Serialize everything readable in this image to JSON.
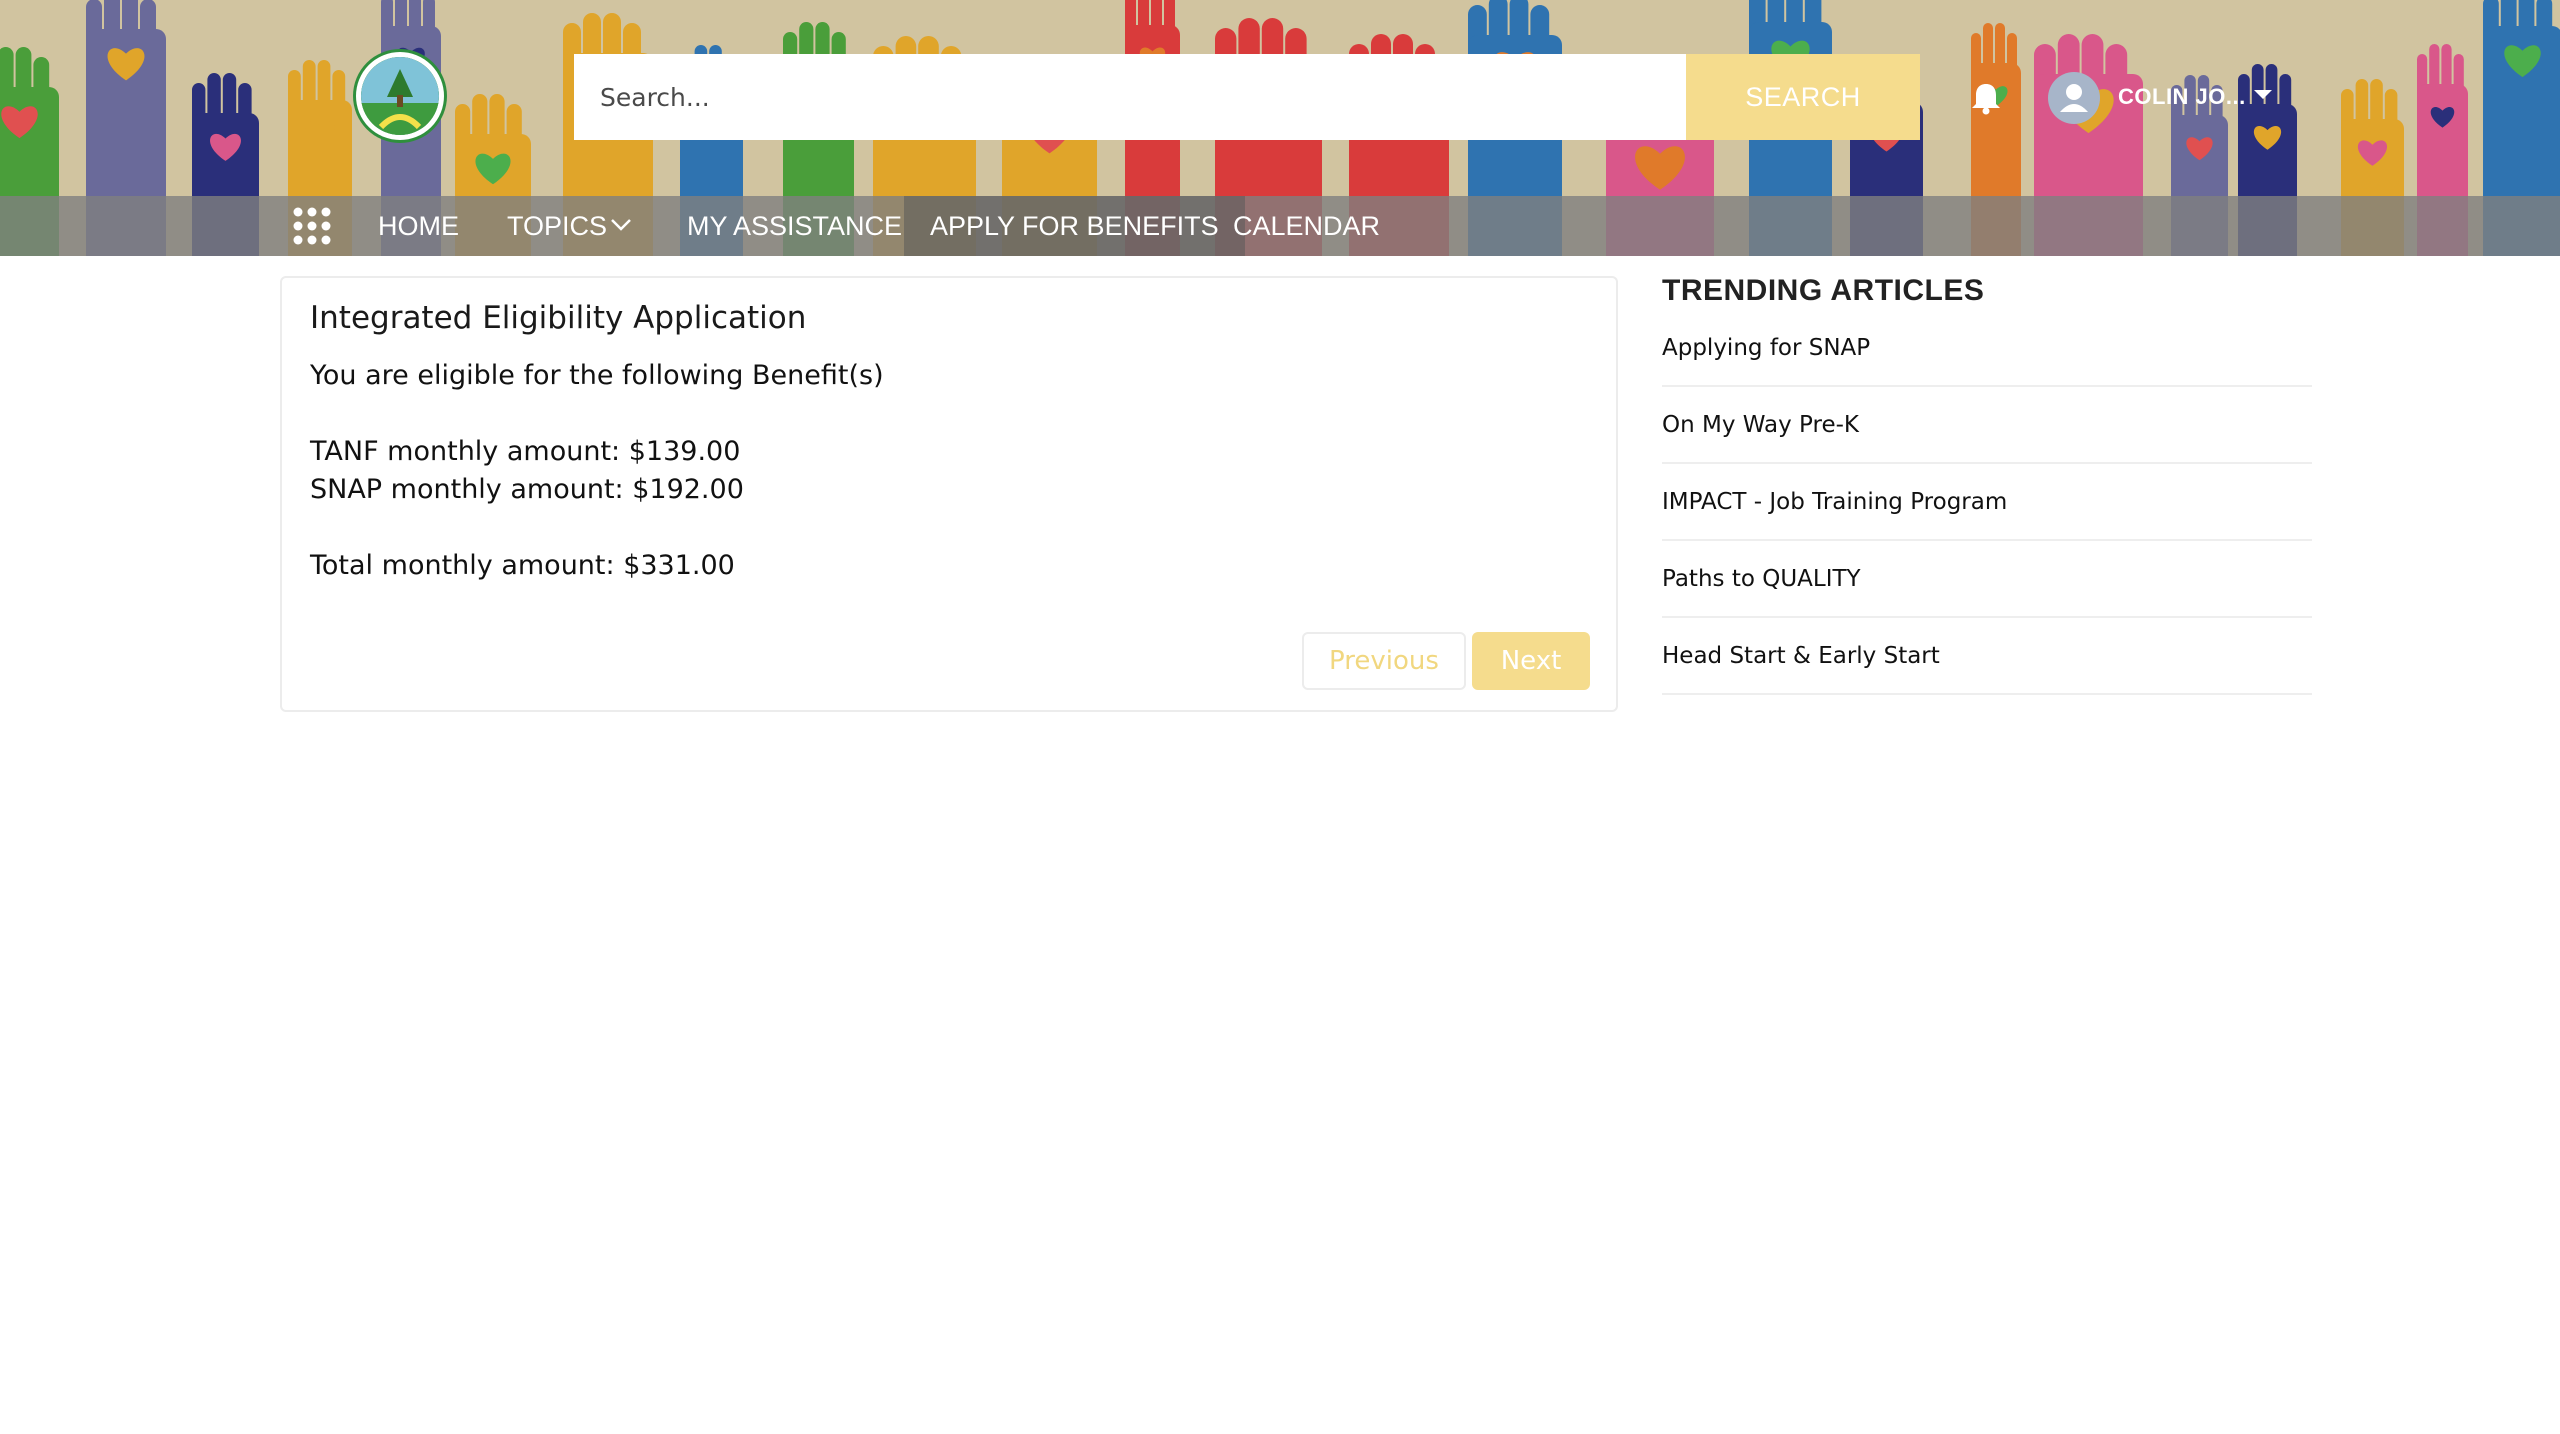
{
  "header": {
    "search": {
      "placeholder": "Search...",
      "button_label": "SEARCH"
    },
    "user": {
      "name": "COLIN JO..."
    },
    "icons": {
      "logo": "agency-logo-tree",
      "bell": "bell-icon",
      "avatar": "user-avatar-icon",
      "grid": "app-launcher-icon"
    }
  },
  "nav": {
    "items": [
      {
        "label": "HOME"
      },
      {
        "label": "TOPICS"
      },
      {
        "label": "MY ASSISTANCE"
      },
      {
        "label": "APPLY FOR BENEFITS"
      },
      {
        "label": "CALENDAR"
      }
    ]
  },
  "card": {
    "title": "Integrated Eligibility Application",
    "intro": "You are eligible for the following Benefit(s)",
    "tanf": "TANF monthly amount: $139.00",
    "snap": "SNAP monthly amount: $192.00",
    "total": "Total monthly amount: $331.00",
    "previous_label": "Previous",
    "next_label": "Next"
  },
  "sidebar": {
    "title": "TRENDING ARTICLES",
    "items": [
      {
        "label": "Applying for SNAP"
      },
      {
        "label": "On My Way Pre-K"
      },
      {
        "label": "IMPACT - Job Training Program"
      },
      {
        "label": "Paths to QUALITY"
      },
      {
        "label": "Head Start & Early Start"
      }
    ]
  },
  "colors": {
    "accent": "#f5dc8d",
    "header_bg": "#d1c4a0",
    "nav_bg": "#808080"
  }
}
